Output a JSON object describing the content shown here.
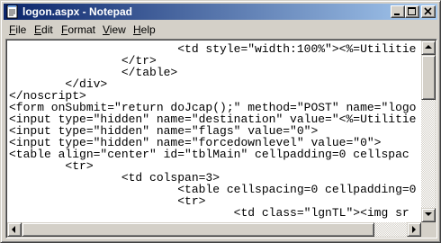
{
  "window": {
    "title": "logon.aspx - Notepad",
    "titlebar_colors": [
      "#0a246a",
      "#a6caf0"
    ]
  },
  "menu": [
    {
      "accel": "F",
      "rest": "ile"
    },
    {
      "accel": "E",
      "rest": "dit"
    },
    {
      "accel": "F",
      "rest": "ormat"
    },
    {
      "accel": "V",
      "rest": "iew"
    },
    {
      "accel": "H",
      "rest": "elp"
    }
  ],
  "editor": {
    "lines": [
      "                        <td style=\"width:100%\"><%=Utilitie",
      "                </tr>",
      "                </table>",
      "        </div>",
      "</noscript>",
      "<form onSubmit=\"return doJcap();\" method=\"POST\" name=\"logo",
      "<input type=\"hidden\" name=\"destination\" value=\"<%=Utilitie",
      "<input type=\"hidden\" name=\"flags\" value=\"0\">",
      "<input type=\"hidden\" name=\"forcedownlevel\" value=\"0\">",
      "<table align=\"center\" id=\"tblMain\" cellpadding=0 cellspac",
      "        <tr>",
      "                <td colspan=3>",
      "                        <table cellspacing=0 cellpadding=0",
      "                        <tr>",
      "                                <td class=\"lgnTL\"><img sr"
    ]
  },
  "icons": {
    "app": "notepad-icon",
    "minimize": "minimize-icon",
    "maximize": "maximize-icon",
    "close": "close-icon"
  }
}
